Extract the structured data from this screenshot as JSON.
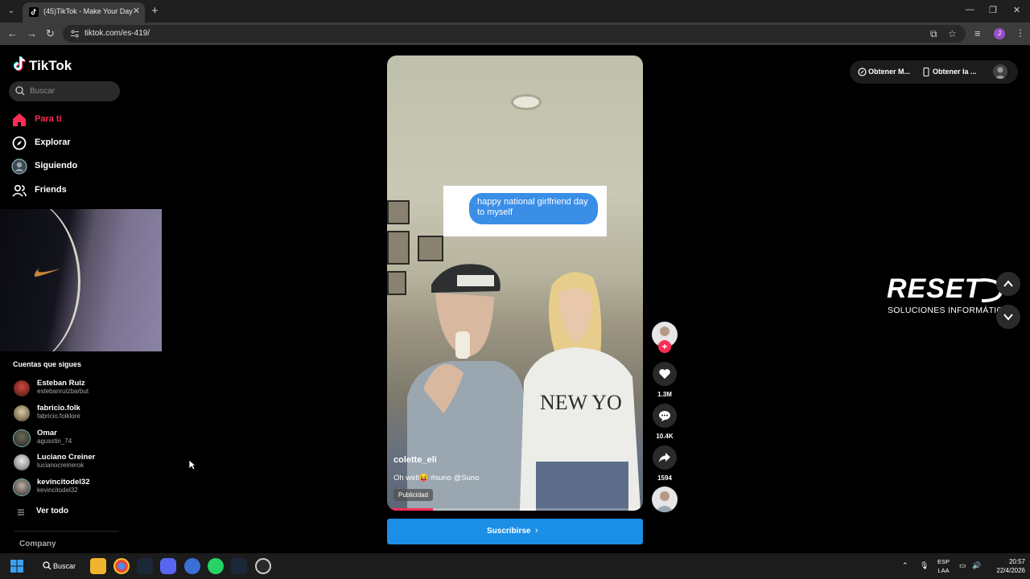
{
  "browser": {
    "tab_title": "(45)TikTok - Make Your Day",
    "url": "tiktok.com/es-419/",
    "profile_initial": "J"
  },
  "app": {
    "logo_text": "TikTok",
    "search_placeholder": "Buscar",
    "nav": [
      {
        "label": "Para ti",
        "icon": "home-icon",
        "active": true
      },
      {
        "label": "Explorar",
        "icon": "compass-icon",
        "active": false
      },
      {
        "label": "Siguiendo",
        "icon": "following-avatar-icon",
        "active": false
      },
      {
        "label": "Friends",
        "icon": "friends-icon",
        "active": false
      }
    ],
    "following_title": "Cuentas que sigues",
    "accounts": [
      {
        "name": "Esteban Ruiz",
        "handle": "estebanruizbarbut"
      },
      {
        "name": "fabricio.folk",
        "handle": "fabricio.folklore"
      },
      {
        "name": "Omar",
        "handle": "agusstin_74"
      },
      {
        "name": "Luciano Creiner",
        "handle": "lucianocreinerok"
      },
      {
        "name": "kevincitodel32",
        "handle": "kevincitodel32"
      }
    ],
    "see_all": "Ver todo",
    "company": "Company"
  },
  "video": {
    "overlay_text": "happy national girlfriend day to myself",
    "username": "colette_eli",
    "caption": "Oh well😝 #suno @Suno",
    "ad_label": "Publicidad",
    "progress": 0.18,
    "cta_label": "Suscribirse"
  },
  "actions": {
    "likes": "1.3M",
    "comments": "10.4K",
    "shares": "1594"
  },
  "top_right": {
    "get_coins": "Obtener M...",
    "get_app": "Obtener la ..."
  },
  "watermark": {
    "title": "RESET",
    "subtitle": "SOLUCIONES INFORMÁTICAS"
  },
  "taskbar": {
    "search_label": "Buscar",
    "lang_top": "ESP",
    "lang_bottom": "LAA",
    "time": "20:57",
    "date": "22/4/2026"
  },
  "colors": {
    "accent": "#fe2c55",
    "cta": "#1b8ee6"
  }
}
